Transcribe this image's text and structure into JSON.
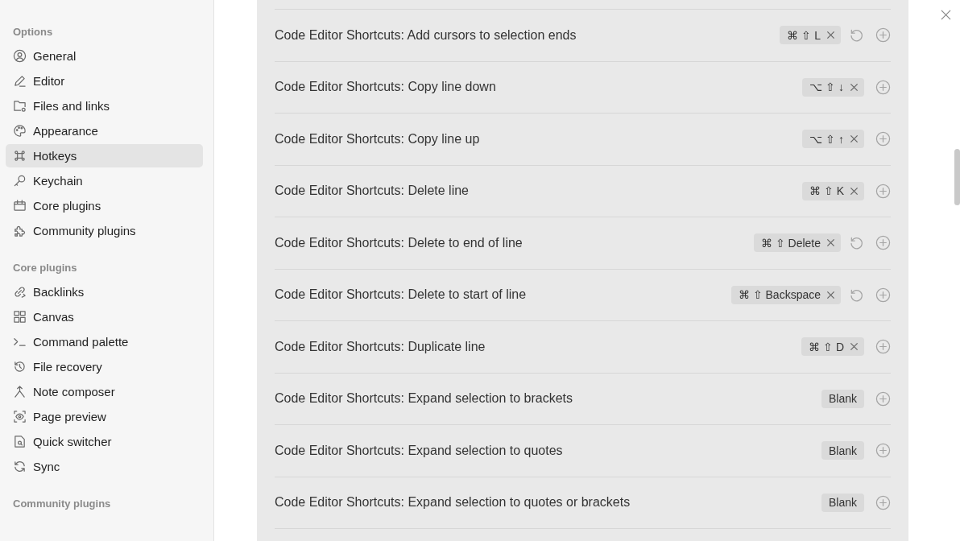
{
  "sidebar": {
    "sections": [
      {
        "heading": "Options",
        "items": [
          {
            "label": "General",
            "selected": false
          },
          {
            "label": "Editor",
            "selected": false
          },
          {
            "label": "Files and links",
            "selected": false
          },
          {
            "label": "Appearance",
            "selected": false
          },
          {
            "label": "Hotkeys",
            "selected": true
          },
          {
            "label": "Keychain",
            "selected": false
          },
          {
            "label": "Core plugins",
            "selected": false
          },
          {
            "label": "Community plugins",
            "selected": false
          }
        ]
      },
      {
        "heading": "Core plugins",
        "items": [
          {
            "label": "Backlinks",
            "selected": false
          },
          {
            "label": "Canvas",
            "selected": false
          },
          {
            "label": "Command palette",
            "selected": false
          },
          {
            "label": "File recovery",
            "selected": false
          },
          {
            "label": "Note composer",
            "selected": false
          },
          {
            "label": "Page preview",
            "selected": false
          },
          {
            "label": "Quick switcher",
            "selected": false
          },
          {
            "label": "Sync",
            "selected": false
          }
        ]
      },
      {
        "heading": "Community plugins"
      }
    ]
  },
  "hotkeys": [
    {
      "command": "Code Editor Shortcuts: Add cursors to selection ends",
      "hotkey": "⌘ ⇧ L",
      "kind": "set",
      "customized": true
    },
    {
      "command": "Code Editor Shortcuts: Copy line down",
      "hotkey": "⌥ ⇧ ↓",
      "kind": "set",
      "customized": false
    },
    {
      "command": "Code Editor Shortcuts: Copy line up",
      "hotkey": "⌥ ⇧ ↑",
      "kind": "set",
      "customized": false
    },
    {
      "command": "Code Editor Shortcuts: Delete line",
      "hotkey": "⌘ ⇧ K",
      "kind": "set",
      "customized": false
    },
    {
      "command": "Code Editor Shortcuts: Delete to end of line",
      "hotkey": "⌘ ⇧ Delete",
      "kind": "set",
      "customized": true
    },
    {
      "command": "Code Editor Shortcuts: Delete to start of line",
      "hotkey": "⌘ ⇧ Backspace",
      "kind": "set",
      "customized": true
    },
    {
      "command": "Code Editor Shortcuts: Duplicate line",
      "hotkey": "⌘ ⇧ D",
      "kind": "set",
      "customized": false
    },
    {
      "command": "Code Editor Shortcuts: Expand selection to brackets",
      "hotkey": "Blank",
      "kind": "blank",
      "customized": false
    },
    {
      "command": "Code Editor Shortcuts: Expand selection to quotes",
      "hotkey": "Blank",
      "kind": "blank",
      "customized": false
    },
    {
      "command": "Code Editor Shortcuts: Expand selection to quotes or brackets",
      "hotkey": "Blank",
      "kind": "blank",
      "customized": false
    }
  ]
}
